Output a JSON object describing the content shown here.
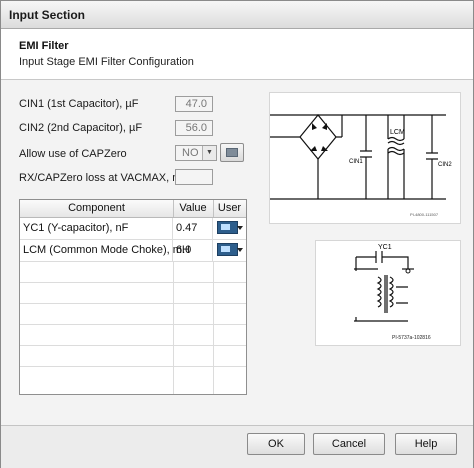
{
  "window": {
    "title": "Input Section"
  },
  "header": {
    "title": "EMI Filter",
    "subtitle": "Input Stage EMI Filter Configuration"
  },
  "fields": {
    "cin1": {
      "label": "CIN1 (1st Capacitor), µF",
      "value": "47.0"
    },
    "cin2": {
      "label": "CIN2 (2nd Capacitor), µF",
      "value": "56.0"
    },
    "capzero": {
      "label": "Allow use of CAPZero",
      "value": "NO"
    },
    "rxloss": {
      "label": "RX/CAPZero loss at VACMAX, mW",
      "value": ""
    }
  },
  "table": {
    "headers": [
      "Component",
      "Value",
      "User"
    ],
    "rows": [
      {
        "component": "YC1 (Y-capacitor), nF",
        "value": "0.47"
      },
      {
        "component": "LCM (Common Mode Choke), mH",
        "value": "6.0"
      }
    ]
  },
  "diagrams": {
    "top": {
      "labels": {
        "lcm": "LCM",
        "cin1": "CIN1",
        "cin2": "CIN2",
        "code": "PI-4800-111507"
      }
    },
    "bottom": {
      "labels": {
        "yc": "YC1",
        "code": "PI-5737a-102816"
      }
    }
  },
  "icons": {
    "config": "configure-icon",
    "user": "user-edit-icon"
  },
  "buttons": {
    "ok": "OK",
    "cancel": "Cancel",
    "help": "Help"
  }
}
